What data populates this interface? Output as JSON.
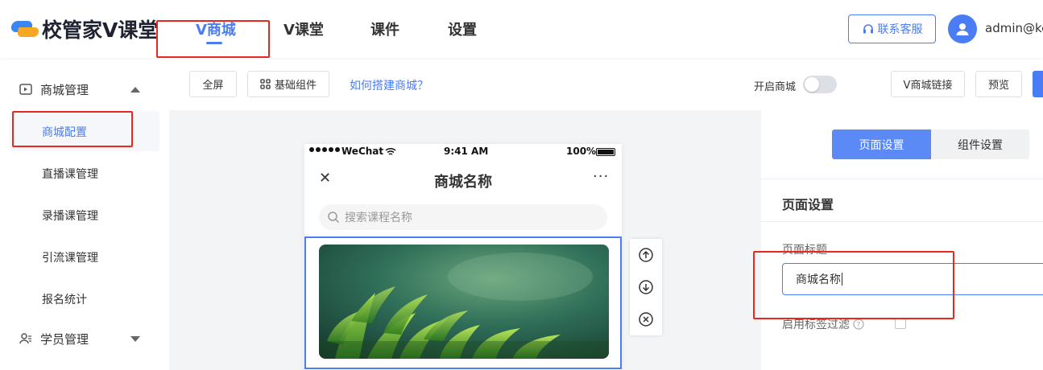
{
  "app": {
    "logo_text": "校管家V课堂",
    "nav": [
      {
        "label": "V商城",
        "active": true
      },
      {
        "label": "V课堂",
        "active": false
      },
      {
        "label": "课件",
        "active": false
      },
      {
        "label": "设置",
        "active": false
      }
    ],
    "customer_service_label": "联系客服",
    "username": "admin@ke"
  },
  "sidebar": {
    "groups": [
      {
        "label": "商城管理",
        "icon": "play-square-icon",
        "expanded": true
      },
      {
        "label": "学员管理",
        "icon": "user-group-icon",
        "expanded": false
      }
    ],
    "items": [
      {
        "label": "商城配置",
        "active": true
      },
      {
        "label": "直播课管理",
        "active": false
      },
      {
        "label": "录播课管理",
        "active": false
      },
      {
        "label": "引流课管理",
        "active": false
      },
      {
        "label": "报名统计",
        "active": false
      }
    ]
  },
  "toolbar": {
    "fullscreen_label": "全屏",
    "components_label": "基础组件",
    "help_link": "如何搭建商城？",
    "toggle_label": "开启商城",
    "toggle_on": false,
    "link_button": "V商城链接",
    "preview_button": "预览"
  },
  "phone": {
    "carrier": "WeChat",
    "time": "9:41 AM",
    "battery": "100%",
    "title": "商城名称",
    "search_placeholder": "搜索课程名称"
  },
  "settings": {
    "tabs": [
      {
        "label": "页面设置",
        "active": true
      },
      {
        "label": "组件设置",
        "active": false
      }
    ],
    "section_title": "页面设置",
    "page_title_label": "页面标题",
    "page_title_value": "商城名称",
    "tag_filter_label": "启用标签过滤",
    "tag_filter_checked": false
  },
  "colors": {
    "accent": "#4a7cf6",
    "annotation": "#e8281f"
  }
}
